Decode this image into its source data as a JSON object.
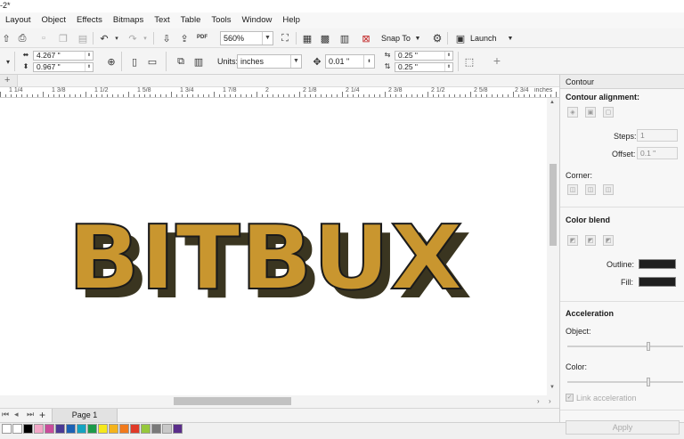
{
  "title": {
    "text": "-2*"
  },
  "menu": [
    "Layout",
    "Object",
    "Effects",
    "Bitmaps",
    "Text",
    "Table",
    "Tools",
    "Window",
    "Help"
  ],
  "toolbar": {
    "pdf_label": "PDF",
    "zoom_value": "560%",
    "snap_to_label": "Snap To",
    "launch_label": "Launch"
  },
  "property_bar": {
    "width_value": "4.267 \"",
    "height_value": "0.967 \"",
    "units_label": "Units:",
    "units_value": "inches",
    "nudge_value": "0.01 \"",
    "dup_x_value": "0.25 \"",
    "dup_y_value": "0.25 \""
  },
  "ruler": {
    "labels": [
      "1 1/4",
      "1 3/8",
      "1 1/2",
      "1 5/8",
      "1 3/4",
      "1 7/8",
      "2",
      "2 1/8",
      "2 1/4",
      "2 3/8",
      "2 1/2",
      "2 5/8",
      "2 3/4"
    ],
    "unit": "inches"
  },
  "canvas": {
    "art_text": "BITBUX",
    "fill_color": "#c9962f",
    "extrude_color": "#3a3520",
    "outline_color": "#1b1b1b"
  },
  "page_nav": {
    "add_label": "+",
    "page_tab": "Page 1"
  },
  "palette": {
    "colors": [
      "#ffffff",
      "#000000",
      "#f2a7c7",
      "#c84c9b",
      "#4a3a94",
      "#1c62b4",
      "#14a3c0",
      "#1c9a4a",
      "#f5e81c",
      "#f4b31c",
      "#f17a1c",
      "#e03a28",
      "#96c83c",
      "#7a7a7a",
      "#c8c8c8",
      "#5a2d8a"
    ]
  },
  "docker": {
    "title": "Contour",
    "alignment_heading": "Contour alignment:",
    "steps_label": "Steps:",
    "steps_value": "1",
    "offset_label": "Offset:",
    "offset_value": "0.1 \"",
    "corner_label": "Corner:",
    "color_blend_heading": "Color blend",
    "outline_label": "Outline:",
    "fill_label": "Fill:",
    "acceleration_heading": "Acceleration",
    "object_label": "Object:",
    "color_label": "Color:",
    "link_label": "Link acceleration",
    "apply_label": "Apply"
  }
}
